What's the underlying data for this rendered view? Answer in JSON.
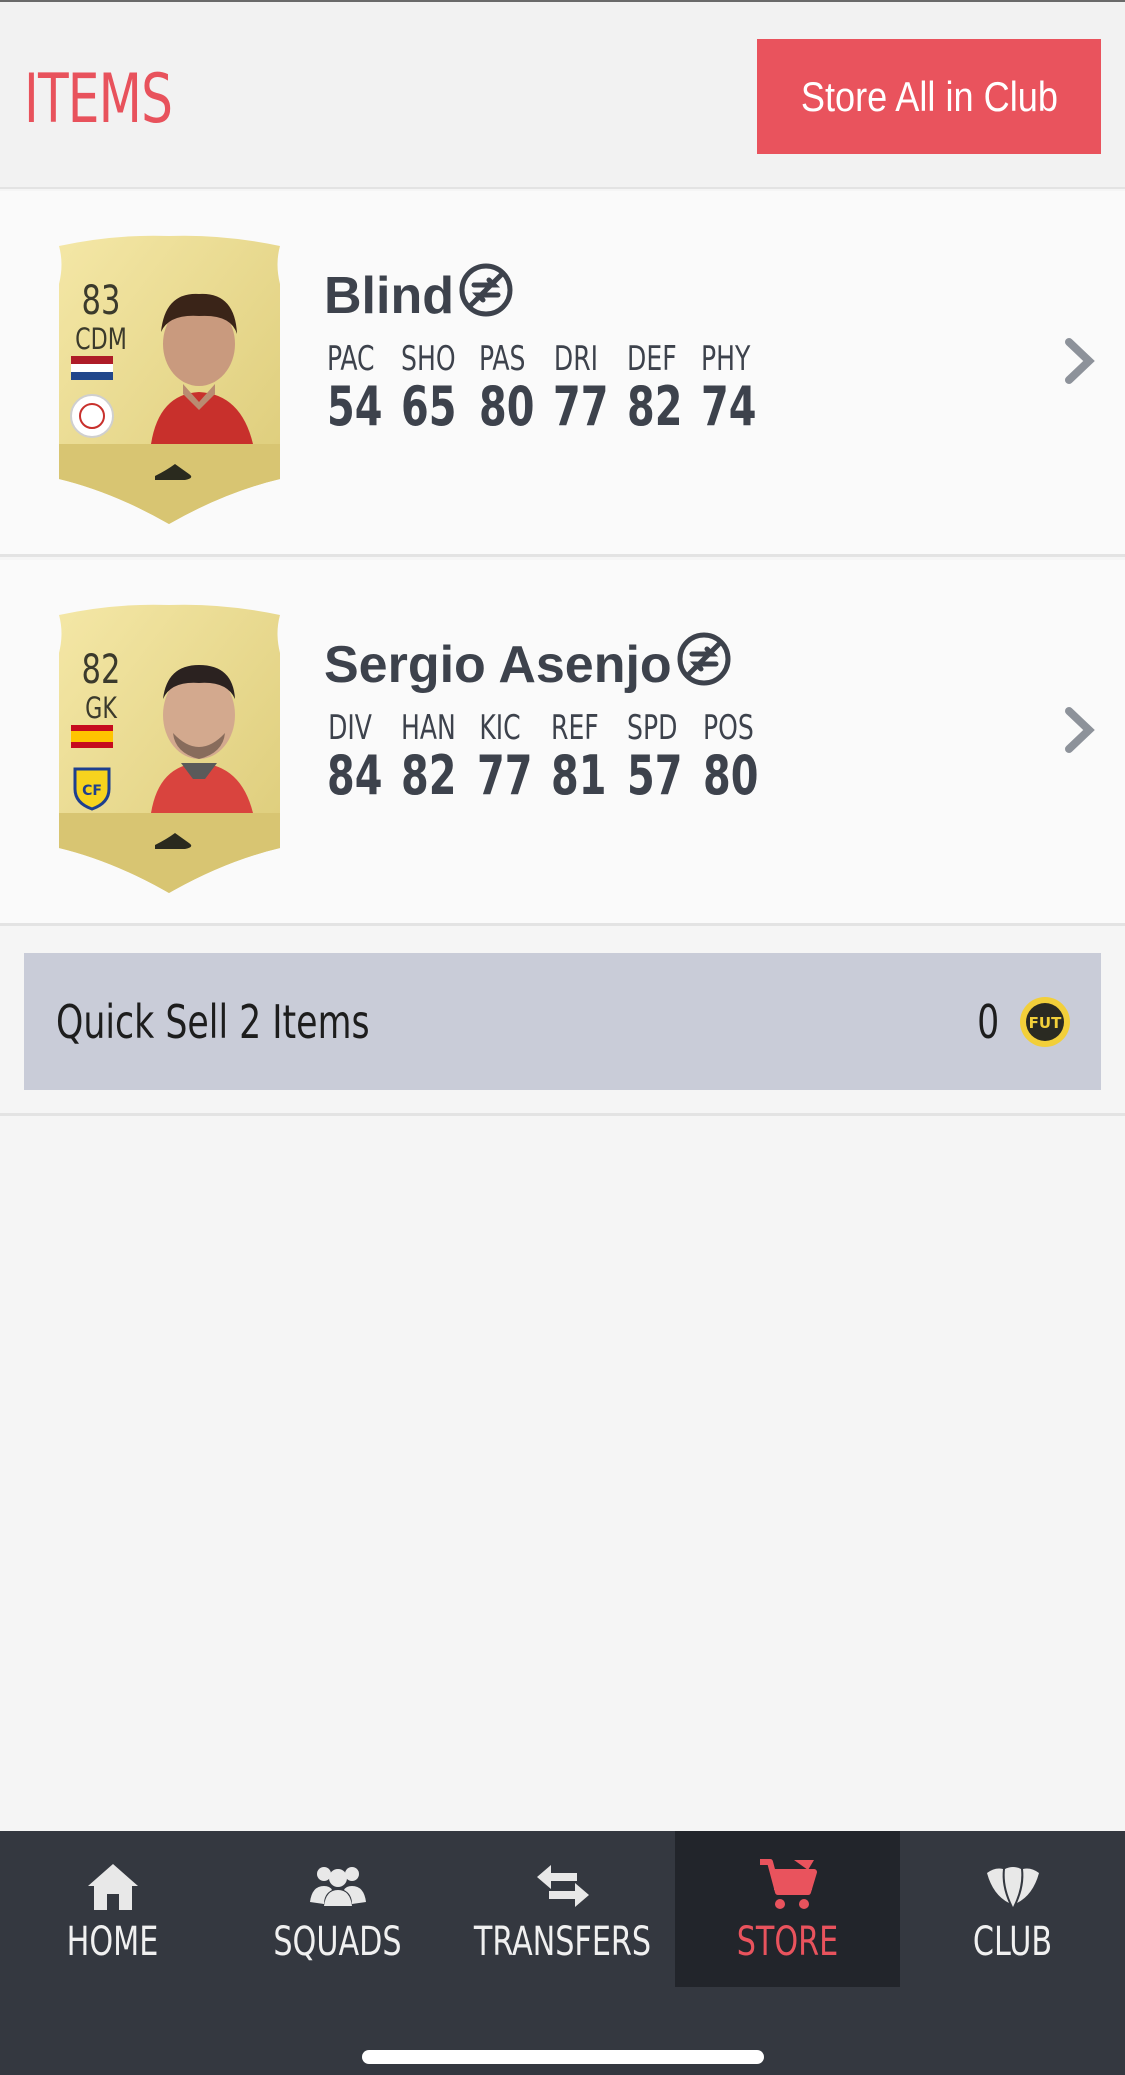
{
  "header": {
    "title": "ITEMS",
    "store_all_label": "Store All in Club"
  },
  "players": [
    {
      "name": "Blind",
      "rating": "83",
      "position": "CDM",
      "stat_labels": [
        "PAC",
        "SHO",
        "PAS",
        "DRI",
        "DEF",
        "PHY"
      ],
      "stat_values": [
        "54",
        "65",
        "80",
        "77",
        "82",
        "74"
      ]
    },
    {
      "name": "Sergio Asenjo",
      "rating": "82",
      "position": "GK",
      "stat_labels": [
        "DIV",
        "HAN",
        "KIC",
        "REF",
        "SPD",
        "POS"
      ],
      "stat_values": [
        "84",
        "82",
        "77",
        "81",
        "57",
        "80"
      ]
    }
  ],
  "quick_sell": {
    "label": "Quick Sell 2 Items",
    "value": "0",
    "coin_text": "FUT"
  },
  "nav": {
    "items": [
      {
        "label": "HOME",
        "icon": "home-icon"
      },
      {
        "label": "SQUADS",
        "icon": "squads-icon"
      },
      {
        "label": "TRANSFERS",
        "icon": "transfers-icon"
      },
      {
        "label": "STORE",
        "icon": "cart-icon"
      },
      {
        "label": "CLUB",
        "icon": "club-icon"
      }
    ],
    "active": "STORE"
  },
  "colors": {
    "accent": "#e9535d",
    "nav_bg": "#343840",
    "nav_active_bg": "#22252b",
    "quick_sell_bg": "#c9ccd8"
  }
}
